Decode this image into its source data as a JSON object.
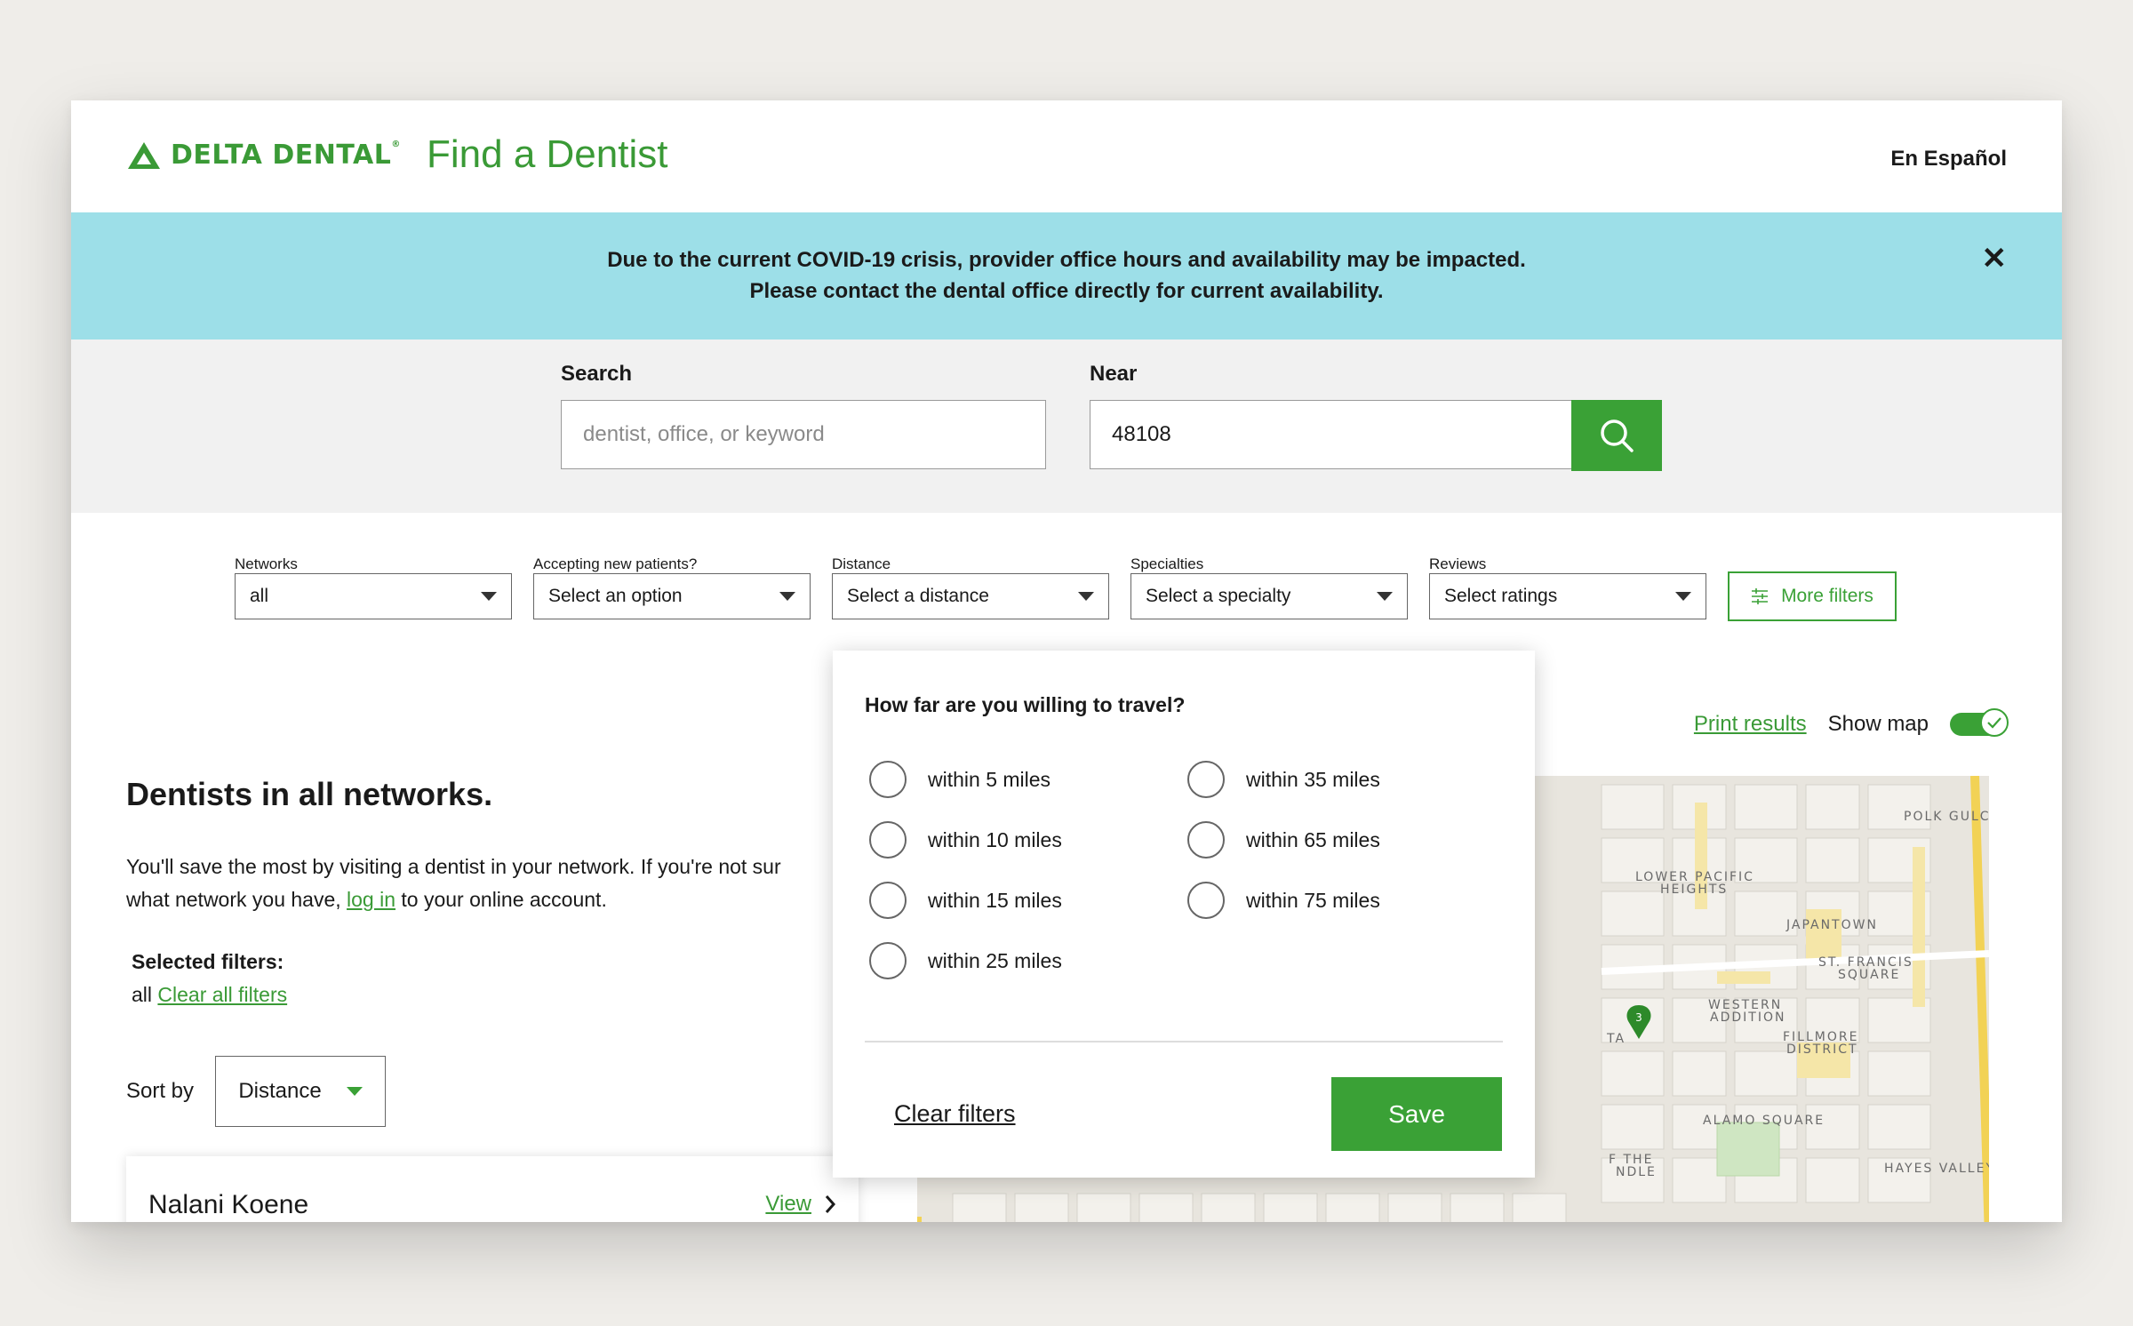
{
  "header": {
    "logo_text": "DELTA DENTAL",
    "logo_tm": "®",
    "app_title": "Find a Dentist",
    "language_link": "En Español"
  },
  "banner": {
    "line1": "Due to the current COVID-19 crisis, provider office hours and availability may be impacted.",
    "line2": "Please contact the dental office directly for current availability.",
    "close_icon": "close-icon"
  },
  "search": {
    "search_label": "Search",
    "search_placeholder": "dentist, office, or keyword",
    "near_label": "Near",
    "near_value": "48108",
    "button_icon": "search-icon"
  },
  "filters": [
    {
      "label": "Networks",
      "value": "all"
    },
    {
      "label": "Accepting new patients?",
      "value": "Select an option"
    },
    {
      "label": "Distance",
      "value": "Select a distance"
    },
    {
      "label": "Specialties",
      "value": "Select a specialty"
    },
    {
      "label": "Reviews",
      "value": "Select ratings"
    }
  ],
  "more_filters": "More filters",
  "map_toolbar": {
    "print_results": "Print results",
    "show_map": "Show map",
    "show_map_on": true
  },
  "results": {
    "title": "Dentists in all networks.",
    "text_before": "You'll save the most by visiting a dentist in your network. If you're not sur",
    "text_line2_before": "what network you have, ",
    "login_link": "log in",
    "text_line2_after": " to your online account.",
    "selected_filters_title": "Selected filters:",
    "selected_filter_value": "all",
    "clear_all_filters": "Clear all filters",
    "sort_label": "Sort by",
    "sort_value": "Distance",
    "first_result_name": "Nalani Koene",
    "view_link": "View"
  },
  "distance_popup": {
    "question": "How far are you willing to travel?",
    "options_left": [
      "within 5 miles",
      "within 10 miles",
      "within 15 miles",
      "within 25 miles"
    ],
    "options_right": [
      "within 35 miles",
      "within 65 miles",
      "within 75 miles"
    ],
    "clear_filters": "Clear filters",
    "save": "Save"
  },
  "map_labels": [
    "POLK GULC",
    "LOWER PACIFIC",
    "HEIGHTS",
    "JAPANTOWN",
    "ST. FRANCIS",
    "SQUARE",
    "WESTERN",
    "ADDITION",
    "FILLMORE",
    "DISTRICT",
    "ALAMO SQUARE",
    "HAYES VALLEY",
    "F THE",
    "NDLE",
    "TA"
  ],
  "colors": {
    "brand_green": "#3aa136",
    "banner_blue": "#9ddfe8",
    "page_bg": "#efede9"
  }
}
